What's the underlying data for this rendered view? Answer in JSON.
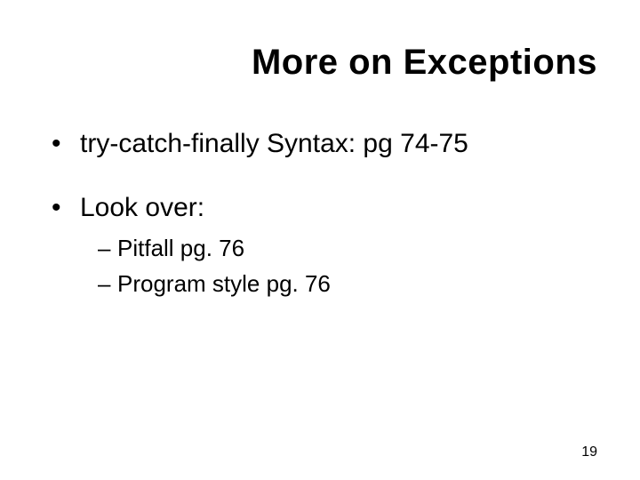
{
  "slide": {
    "title": "More on Exceptions",
    "bullets": [
      {
        "text": "try-catch-finally Syntax: pg 74-75",
        "children": []
      },
      {
        "text": "Look over:",
        "children": [
          {
            "text": "Pitfall pg. 76"
          },
          {
            "text": "Program style pg. 76"
          }
        ]
      }
    ],
    "page_number": "19"
  }
}
